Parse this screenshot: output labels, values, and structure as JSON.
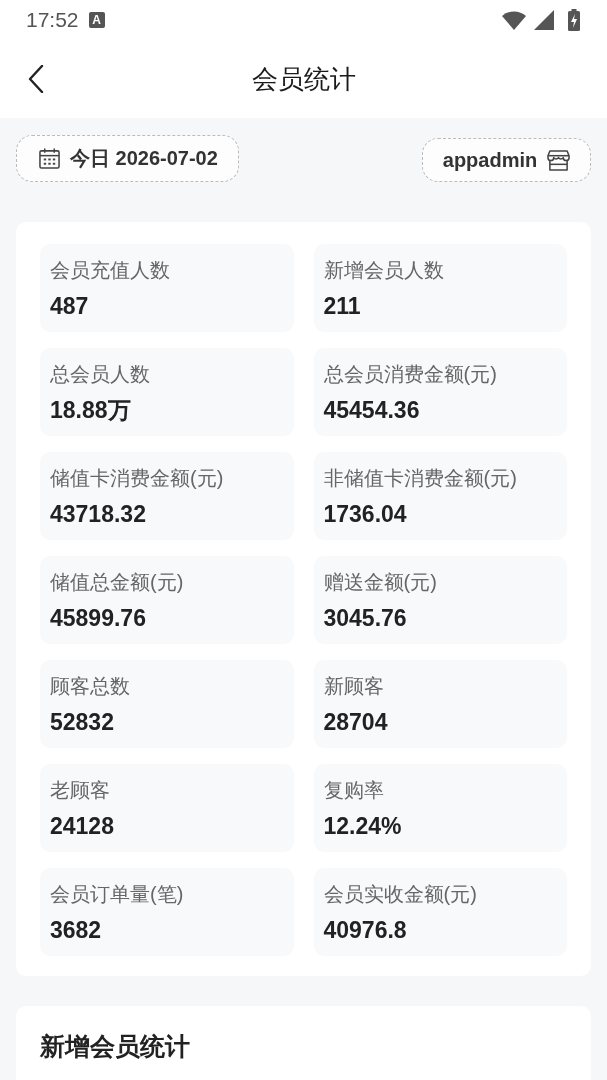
{
  "status_bar": {
    "time": "17:52",
    "notification_glyph": "A"
  },
  "header": {
    "title": "会员统计"
  },
  "filters": {
    "date_label": "今日 2026-07-02",
    "store_label": "appadmin"
  },
  "stats": [
    {
      "label": "会员充值人数",
      "value": "487"
    },
    {
      "label": "新增会员人数",
      "value": "211"
    },
    {
      "label": "总会员人数",
      "value": "18.88万"
    },
    {
      "label": "总会员消费金额(元)",
      "value": "45454.36"
    },
    {
      "label": "储值卡消费金额(元)",
      "value": "43718.32"
    },
    {
      "label": "非储值卡消费金额(元)",
      "value": "1736.04"
    },
    {
      "label": "储值总金额(元)",
      "value": "45899.76"
    },
    {
      "label": "赠送金额(元)",
      "value": "3045.76"
    },
    {
      "label": "顾客总数",
      "value": "52832"
    },
    {
      "label": "新顾客",
      "value": "28704"
    },
    {
      "label": "老顾客",
      "value": "24128"
    },
    {
      "label": "复购率",
      "value": "12.24%"
    },
    {
      "label": "会员订单量(笔)",
      "value": "3682"
    },
    {
      "label": "会员实收金额(元)",
      "value": "40976.8"
    }
  ],
  "section": {
    "title": "新增会员统计"
  }
}
